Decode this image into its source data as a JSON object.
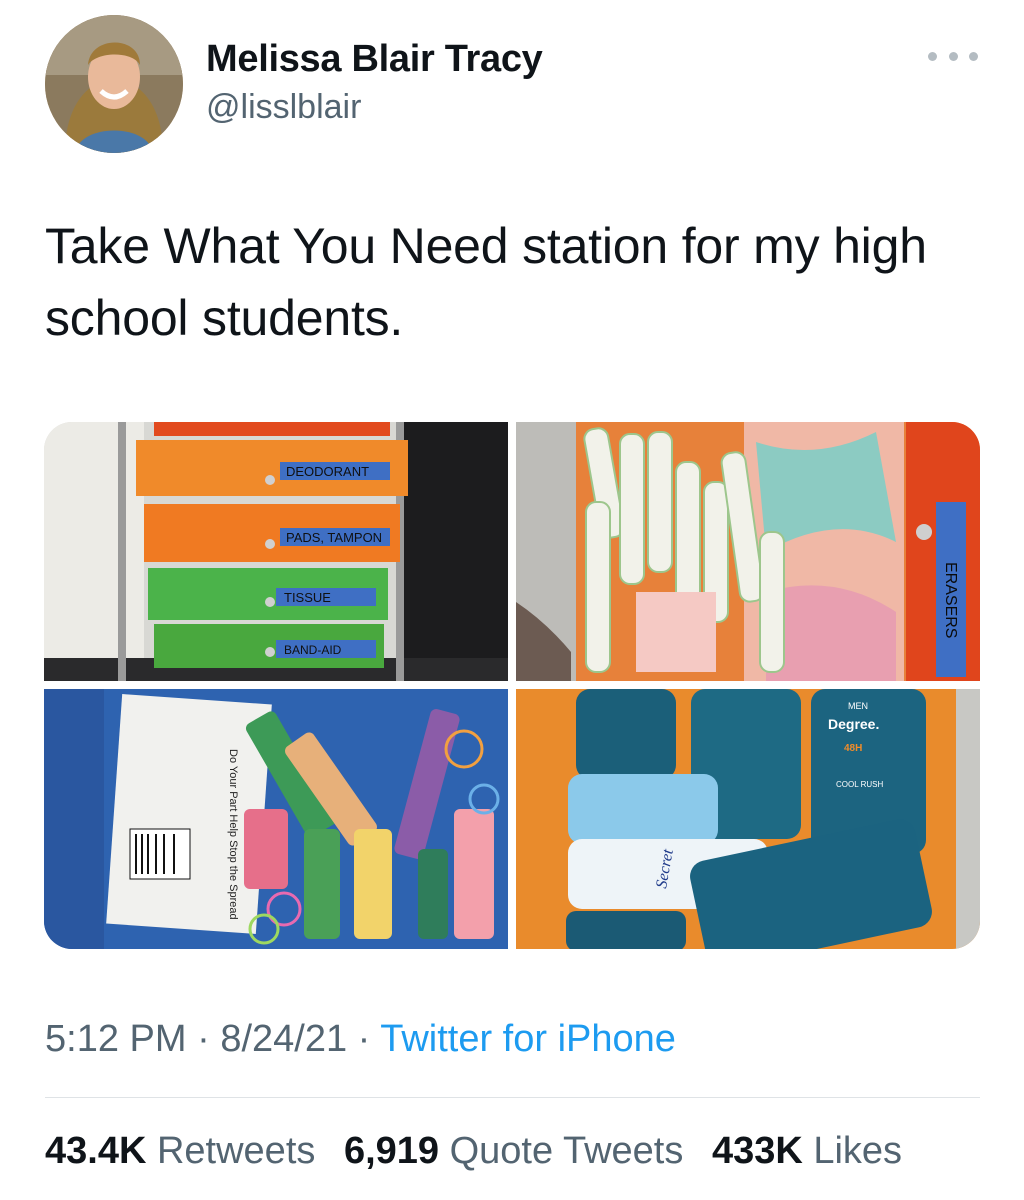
{
  "author": {
    "name": "Melissa Blair Tracy",
    "handle": "@lisslblair",
    "avatar_icon": "profile-photo"
  },
  "tweet": {
    "text": "Take What You Need station for my high school students."
  },
  "media": [
    {
      "description_icon": "organizer-drawers-photo",
      "drawer_labels": [
        "DEODORANT",
        "PADS, TAMPON",
        "TISSUE",
        "BAND-AID"
      ]
    },
    {
      "description_icon": "tampons-pads-photo",
      "side_label": "ERASERS"
    },
    {
      "description_icon": "masks-lotions-hairties-photo",
      "package_text": "Do Your Part Help Stop the Spread"
    },
    {
      "description_icon": "deodorants-photo",
      "brand_top": "Degree.",
      "brand_top_sub": "MEN",
      "variant": "COOL RUSH",
      "claim": "48H",
      "brand_secondary": "Secret"
    }
  ],
  "meta": {
    "time": "5:12 PM",
    "separator": " · ",
    "date": "8/24/21",
    "source": "Twitter for iPhone"
  },
  "stats": {
    "retweets_count": "43.4K",
    "retweets_label": "Retweets",
    "quotes_count": "6,919",
    "quotes_label": "Quote Tweets",
    "likes_count": "433K",
    "likes_label": "Likes"
  },
  "colors": {
    "link": "#1d9bf0",
    "secondary_text": "#536471",
    "primary_text": "#0f1419"
  }
}
